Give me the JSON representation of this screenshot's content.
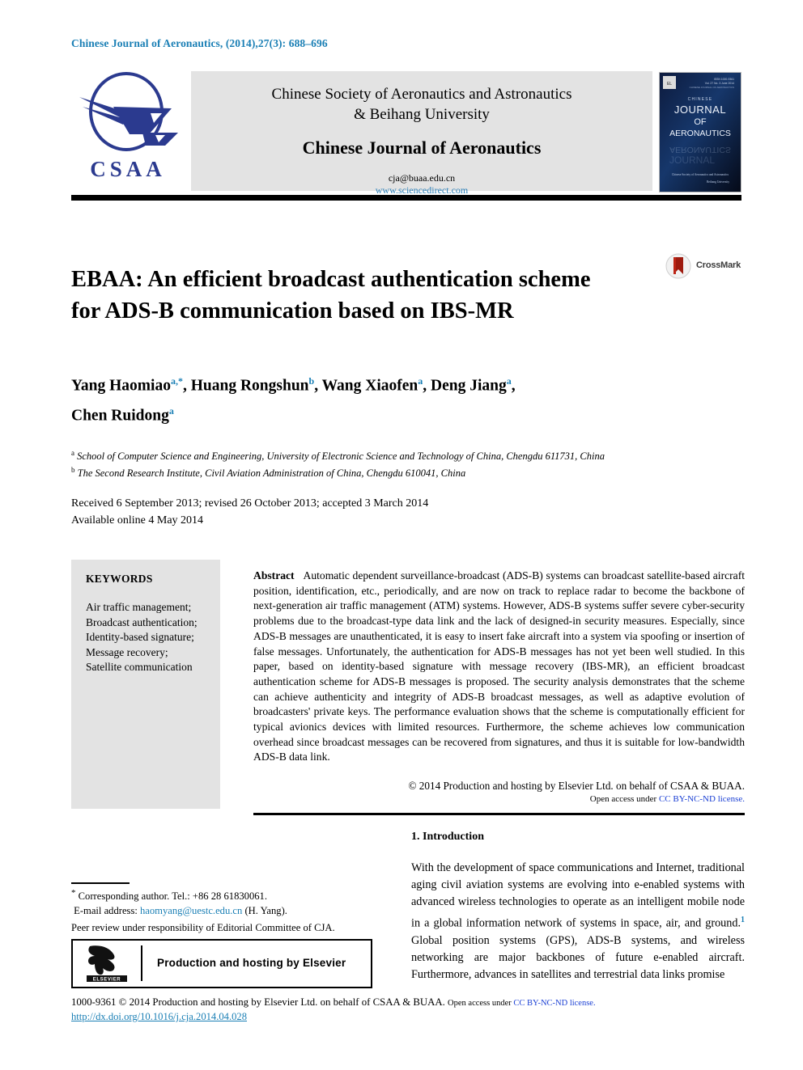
{
  "running_head": "Chinese Journal of Aeronautics, (2014),27(3): 688–696",
  "masthead": {
    "logo_word": "CSAA",
    "society_line1": "Chinese Society of Aeronautics and Astronautics",
    "society_line2": "& Beihang University",
    "journal_name": "Chinese Journal of Aeronautics",
    "email": "cja@buaa.edu.cn",
    "url": "www.sciencedirect.com",
    "cover": {
      "line_chinese": "CHINESE",
      "line1": "JOURNAL",
      "line2": "OF",
      "line3": "AERONAUTICS",
      "footer1": "Chinese Society of Aeronautics and Astronautics",
      "footer2": "Beihang University"
    }
  },
  "article": {
    "title": "EBAA: An efficient broadcast authentication scheme for ADS-B communication based on IBS-MR",
    "crossmark_label": "CrossMark",
    "authors": [
      {
        "name": "Yang Haomiao",
        "marks": "a,*"
      },
      {
        "name": "Huang Rongshun",
        "marks": "b"
      },
      {
        "name": "Wang Xiaofen",
        "marks": "a"
      },
      {
        "name": "Deng Jiang",
        "marks": "a"
      },
      {
        "name": "Chen Ruidong",
        "marks": "a"
      }
    ],
    "affiliations": [
      {
        "mark": "a",
        "text": "School of Computer Science and Engineering, University of Electronic Science and Technology of China, Chengdu 611731, China"
      },
      {
        "mark": "b",
        "text": "The Second Research Institute, Civil Aviation Administration of China, Chengdu 610041, China"
      }
    ],
    "dates_line1": "Received 6 September 2013; revised 26 October 2013; accepted 3 March 2014",
    "dates_line2": "Available online 4 May 2014"
  },
  "keywords": {
    "heading": "KEYWORDS",
    "items": [
      "Air traffic management;",
      "Broadcast authentication;",
      "Identity-based signature;",
      "Message recovery;",
      "Satellite communication"
    ]
  },
  "abstract": {
    "label": "Abstract",
    "text": "Automatic dependent surveillance-broadcast (ADS-B) systems can broadcast satellite-based aircraft position, identification, etc., periodically, and are now on track to replace radar to become the backbone of next-generation air traffic management (ATM) systems. However, ADS-B systems suffer severe cyber-security problems due to the broadcast-type data link and the lack of designed-in security measures. Especially, since ADS-B messages are unauthenticated, it is easy to insert fake aircraft into a system via spoofing or insertion of false messages. Unfortunately, the authentication for ADS-B messages has not yet been well studied. In this paper, based on identity-based signature with message recovery (IBS-MR), an efficient broadcast authentication scheme for ADS-B messages is proposed. The security analysis demonstrates that the scheme can achieve authenticity and integrity of ADS-B broadcast messages, as well as adaptive evolution of broadcasters' private keys. The performance evaluation shows that the scheme is computationally efficient for typical avionics devices with limited resources. Furthermore, the scheme achieves low communication overhead since broadcast messages can be recovered from signatures, and thus it is suitable for low-bandwidth ADS-B data link.",
    "copyright": "© 2014 Production and hosting by Elsevier Ltd. on behalf of CSAA & BUAA.",
    "open_access_prefix": "Open access under ",
    "open_access_link": "CC BY-NC-ND license."
  },
  "introduction": {
    "heading": "1. Introduction",
    "paragraph_part1": "With the development of space communications and Internet, traditional aging civil aviation systems are evolving into e-enabled systems with advanced wireless technologies to operate as an intelligent mobile node in a global information network of systems in space, air, and ground.",
    "reference_mark": "1",
    "paragraph_part2": " Global position systems (GPS), ADS-B systems, and wireless networking are major backbones of future e-enabled aircraft. Furthermore, advances in satellites and terrestrial data links promise"
  },
  "footnotes": {
    "corresponding_star": "*",
    "corresponding": " Corresponding author. Tel.: +86 28 61830061.",
    "email_label": "E-mail address: ",
    "email": "haomyang@uestc.edu.cn",
    "email_suffix": " (H. Yang).",
    "peer_review": "Peer review under responsibility of Editorial Committee of CJA.",
    "elsevier_box_text": "Production and hosting by Elsevier",
    "elsevier_logo_word": "ELSEVIER"
  },
  "bottom": {
    "copyright_main": "1000-9361 © 2014 Production and hosting by Elsevier Ltd. on behalf of CSAA & BUAA. ",
    "open_access_prefix": "Open access under ",
    "open_access_link": "CC BY-NC-ND license.",
    "doi": "http://dx.doi.org/10.1016/j.cja.2014.04.028"
  },
  "colors": {
    "accent_blue": "#1a7fb5",
    "logo_blue": "#2b3a8f",
    "link_blue": "#1a3fd4",
    "box_gray": "#e3e3e3"
  }
}
